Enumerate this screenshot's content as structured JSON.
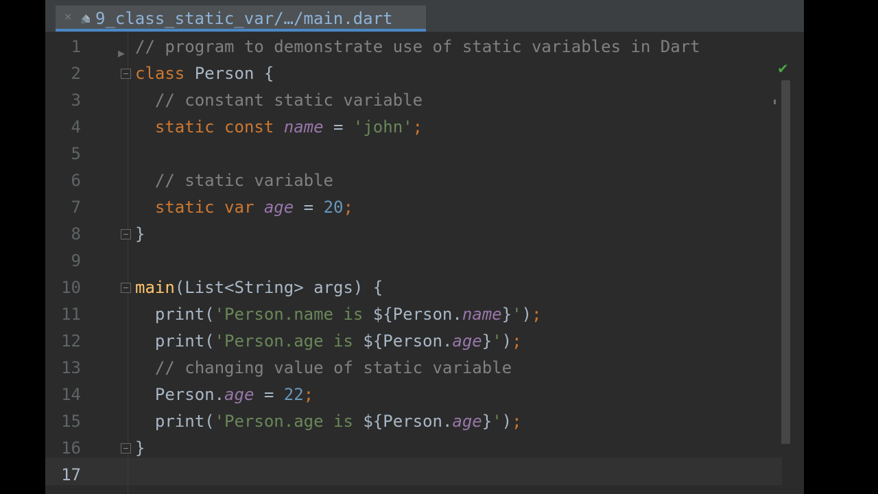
{
  "tab": {
    "close_symbol": "×",
    "label": "9_class_static_var/…/main.dart",
    "icon": "dart-file-icon"
  },
  "inspection": {
    "status_symbol": "✔",
    "status_color": "#49a73f"
  },
  "colors": {
    "background": "#2b2b2b",
    "keyword": "#cc7832",
    "comment": "#808080",
    "string": "#6a8759",
    "number": "#6897bb",
    "field": "#9876aa",
    "function": "#ffc66d",
    "text": "#a9b7c6",
    "tab_underline": "#4a88c7"
  },
  "editor": {
    "current_line": 17,
    "lines": [
      {
        "n": "1",
        "tokens": [
          {
            "t": "// program to demonstrate use of static variables in Dart",
            "c": "comment"
          }
        ]
      },
      {
        "n": "2",
        "tokens": [
          {
            "t": "class",
            "c": "kw"
          },
          {
            "t": " Person {",
            "c": "plain"
          }
        ]
      },
      {
        "n": "3",
        "tokens": [
          {
            "t": "  // constant static variable",
            "c": "comment"
          }
        ]
      },
      {
        "n": "4",
        "tokens": [
          {
            "t": "  static const ",
            "c": "kw"
          },
          {
            "t": "name",
            "c": "field"
          },
          {
            "t": " = ",
            "c": "plain"
          },
          {
            "t": "'john'",
            "c": "str"
          },
          {
            "t": ";",
            "c": "kw"
          }
        ]
      },
      {
        "n": "5",
        "tokens": []
      },
      {
        "n": "6",
        "tokens": [
          {
            "t": "  // static variable",
            "c": "comment"
          }
        ]
      },
      {
        "n": "7",
        "tokens": [
          {
            "t": "  static var ",
            "c": "kw"
          },
          {
            "t": "age",
            "c": "field"
          },
          {
            "t": " = ",
            "c": "plain"
          },
          {
            "t": "20",
            "c": "num"
          },
          {
            "t": ";",
            "c": "kw"
          }
        ]
      },
      {
        "n": "8",
        "tokens": [
          {
            "t": "}",
            "c": "plain"
          }
        ]
      },
      {
        "n": "9",
        "tokens": []
      },
      {
        "n": "10",
        "tokens": [
          {
            "t": "main",
            "c": "fn"
          },
          {
            "t": "(List<String> args) {",
            "c": "plain"
          }
        ]
      },
      {
        "n": "11",
        "tokens": [
          {
            "t": "  print(",
            "c": "plain"
          },
          {
            "t": "'Person.name is ",
            "c": "str"
          },
          {
            "t": "${Person.",
            "c": "plain"
          },
          {
            "t": "name",
            "c": "field"
          },
          {
            "t": "}",
            "c": "plain"
          },
          {
            "t": "'",
            "c": "str"
          },
          {
            "t": ")",
            "c": "plain"
          },
          {
            "t": ";",
            "c": "kw"
          }
        ]
      },
      {
        "n": "12",
        "tokens": [
          {
            "t": "  print(",
            "c": "plain"
          },
          {
            "t": "'Person.age is ",
            "c": "str"
          },
          {
            "t": "${Person.",
            "c": "plain"
          },
          {
            "t": "age",
            "c": "field"
          },
          {
            "t": "}",
            "c": "plain"
          },
          {
            "t": "'",
            "c": "str"
          },
          {
            "t": ")",
            "c": "plain"
          },
          {
            "t": ";",
            "c": "kw"
          }
        ]
      },
      {
        "n": "13",
        "tokens": [
          {
            "t": "  // changing value of static variable",
            "c": "comment"
          }
        ]
      },
      {
        "n": "14",
        "tokens": [
          {
            "t": "  Person.",
            "c": "plain"
          },
          {
            "t": "age",
            "c": "field"
          },
          {
            "t": " = ",
            "c": "plain"
          },
          {
            "t": "22",
            "c": "num"
          },
          {
            "t": ";",
            "c": "kw"
          }
        ]
      },
      {
        "n": "15",
        "tokens": [
          {
            "t": "  print(",
            "c": "plain"
          },
          {
            "t": "'Person.age is ",
            "c": "str"
          },
          {
            "t": "${Person.",
            "c": "plain"
          },
          {
            "t": "age",
            "c": "field"
          },
          {
            "t": "}",
            "c": "plain"
          },
          {
            "t": "'",
            "c": "str"
          },
          {
            "t": ")",
            "c": "plain"
          },
          {
            "t": ";",
            "c": "kw"
          }
        ]
      },
      {
        "n": "16",
        "tokens": [
          {
            "t": "}",
            "c": "plain"
          }
        ]
      },
      {
        "n": "17",
        "tokens": []
      }
    ]
  }
}
